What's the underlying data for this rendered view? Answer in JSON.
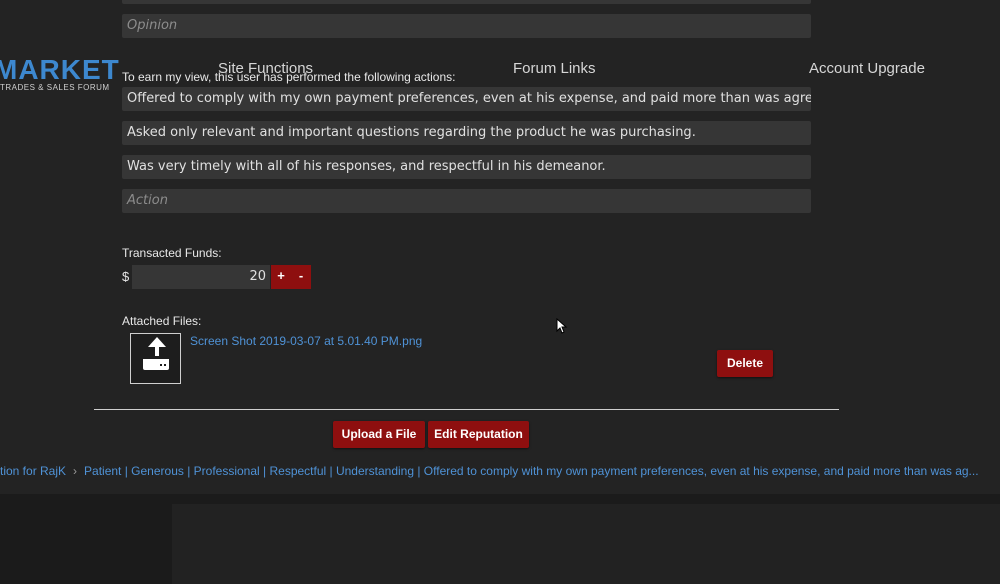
{
  "form": {
    "top_field_value": "",
    "opinion_placeholder": "Opinion",
    "actions_label": "To earn my view, this user has performed the following actions:",
    "actions": [
      "Offered to comply with my own payment preferences, even at his expense, and paid more than was agreed up",
      "Asked only relevant and important questions regarding the product he was purchasing.",
      "Was very timely with all of his responses, and respectful in his demeanor."
    ],
    "action_placeholder": "Action",
    "funds_label": "Transacted Funds:",
    "currency_symbol": "$",
    "funds_value": "20",
    "plus_label": "+",
    "minus_label": "-",
    "attached_label": "Attached Files:",
    "file_name": "Screen Shot 2019-03-07 at 5.01.40 PM.png",
    "delete_label": "Delete",
    "upload_label": "Upload a File",
    "edit_label": "Edit Reputation"
  },
  "breadcrumb": {
    "item1": "tion for RajK",
    "item2": "Patient | Generous | Professional | Respectful | Understanding | Offered to comply with my own payment preferences, even at his expense, and paid more than was ag..."
  },
  "footer": {
    "logo_text": "MARKET",
    "logo_subtext": "TRADES & SALES FORUM",
    "headings": [
      "Site Functions",
      "Forum Links",
      "Account Upgrade"
    ]
  },
  "colors": {
    "accent_red": "#8e0f0f",
    "link_blue": "#4f92d6",
    "logo_blue": "#3d88cf",
    "background": "#232323"
  },
  "icons": {
    "upload": "upload-icon",
    "cursor": "mouse-cursor-icon",
    "breadcrumb_separator": "chevron-right-icon"
  }
}
